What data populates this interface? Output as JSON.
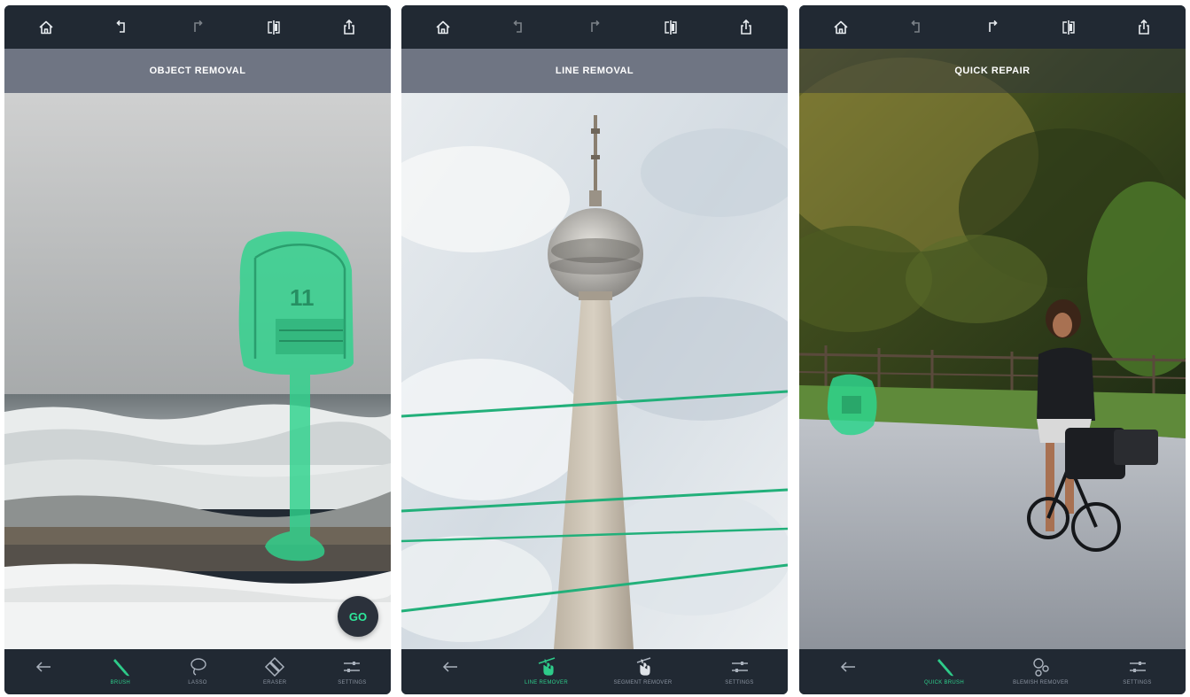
{
  "colors": {
    "accent": "#2ecc8a",
    "bar": "#212933",
    "mode_bar": "#6f7583"
  },
  "toolbar_icons": [
    "home-icon",
    "undo-icon",
    "redo-icon",
    "compare-icon",
    "share-icon"
  ],
  "panels": [
    {
      "mode_title": "OBJECT REMOVAL",
      "go_label": "GO",
      "bottom_tools": [
        {
          "icon": "back-arrow-icon",
          "label": ""
        },
        {
          "icon": "brush-icon",
          "label": "BRUSH",
          "active": true
        },
        {
          "icon": "lasso-icon",
          "label": "LASSO"
        },
        {
          "icon": "eraser-icon",
          "label": "ERASER"
        },
        {
          "icon": "settings-sliders-icon",
          "label": "SETTINGS"
        }
      ]
    },
    {
      "mode_title": "LINE REMOVAL",
      "bottom_tools": [
        {
          "icon": "back-arrow-icon",
          "label": ""
        },
        {
          "icon": "line-remover-icon",
          "label": "LINE REMOVER",
          "active": true
        },
        {
          "icon": "segment-remover-icon",
          "label": "SEGMENT REMOVER"
        },
        {
          "icon": "settings-sliders-icon",
          "label": "SETTINGS"
        }
      ]
    },
    {
      "mode_title": "QUICK REPAIR",
      "bottom_tools": [
        {
          "icon": "back-arrow-icon",
          "label": ""
        },
        {
          "icon": "quick-brush-icon",
          "label": "QUICK BRUSH",
          "active": true
        },
        {
          "icon": "blemish-remover-icon",
          "label": "BLEMISH REMOVER"
        },
        {
          "icon": "settings-sliders-icon",
          "label": "SETTINGS"
        }
      ]
    }
  ]
}
